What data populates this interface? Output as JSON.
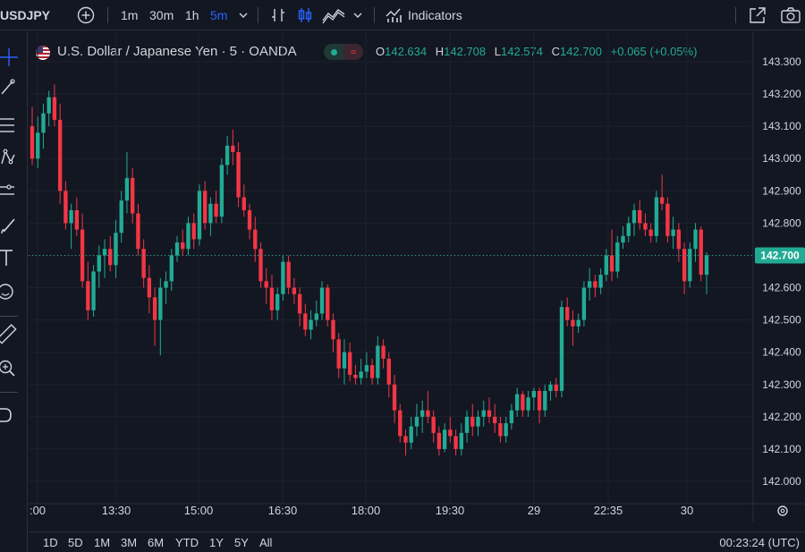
{
  "toolbar": {
    "symbol": "USDJPY",
    "intervals": [
      "1m",
      "30m",
      "1h",
      "5m"
    ],
    "active_interval": "5m",
    "indicators_label": "Indicators",
    "icons": [
      "add-symbol-icon",
      "chevron-down-icon",
      "bar-style-icon",
      "candle-style-icon",
      "area-style-icon",
      "indicators-icon",
      "fullscreen-icon",
      "camera-icon"
    ]
  },
  "legend": {
    "title": "U.S. Dollar / Japanese Yen · 5 · OANDA",
    "open_label": "O",
    "open": "142.634",
    "high_label": "H",
    "high": "142.708",
    "low_label": "L",
    "low": "142.574",
    "close_label": "C",
    "close": "142.700",
    "change": "+0.065 (+0.05%)",
    "wave_glyph": "≈"
  },
  "left_tools": [
    "crosshair-icon",
    "trendline-icon",
    "fib-icon",
    "pattern-icon",
    "projection-icon",
    "brush-icon",
    "text-icon",
    "emoji-icon",
    "ruler-icon",
    "zoom-icon",
    "magnet-icon"
  ],
  "bottom": {
    "ranges": [
      "1D",
      "5D",
      "1M",
      "3M",
      "6M",
      "YTD",
      "1Y",
      "5Y",
      "All"
    ],
    "clock": "00:23:24 (UTC)"
  },
  "colors": {
    "up": "#22ab94",
    "down": "#f23645",
    "background": "#131722",
    "grid": "#1e222d",
    "accent": "#2962ff"
  },
  "chart_data": {
    "type": "candlestick",
    "ylim": [
      141.95,
      143.35
    ],
    "y_ticks": [
      "143.300",
      "143.200",
      "143.100",
      "143.000",
      "142.900",
      "142.800",
      "142.700",
      "142.600",
      "142.500",
      "142.400",
      "142.300",
      "142.200",
      "142.100",
      "142.000"
    ],
    "x_ticks": [
      ":00",
      "13:30",
      "15:00",
      "16:30",
      "18:00",
      "19:30",
      "29",
      "22:35",
      "30"
    ],
    "last_price": "142.700",
    "candles": [
      [
        143.1,
        143.16,
        142.98,
        143.0
      ],
      [
        143.0,
        143.13,
        142.97,
        143.08
      ],
      [
        143.08,
        143.17,
        143.03,
        143.14
      ],
      [
        143.14,
        143.21,
        143.1,
        143.19
      ],
      [
        143.19,
        143.23,
        143.1,
        143.12
      ],
      [
        143.12,
        143.17,
        142.86,
        142.9
      ],
      [
        142.9,
        142.93,
        142.78,
        142.8
      ],
      [
        142.8,
        142.86,
        142.72,
        142.84
      ],
      [
        142.84,
        142.88,
        142.76,
        142.78
      ],
      [
        142.78,
        142.83,
        142.6,
        142.62
      ],
      [
        142.62,
        142.68,
        142.5,
        142.53
      ],
      [
        142.53,
        142.67,
        142.51,
        142.65
      ],
      [
        142.65,
        142.73,
        142.6,
        142.7
      ],
      [
        142.7,
        142.75,
        142.63,
        142.72
      ],
      [
        142.72,
        142.76,
        142.65,
        142.67
      ],
      [
        142.67,
        142.81,
        142.63,
        142.77
      ],
      [
        142.77,
        142.9,
        142.74,
        142.87
      ],
      [
        142.87,
        143.02,
        142.83,
        142.94
      ],
      [
        142.94,
        142.97,
        142.8,
        142.83
      ],
      [
        142.83,
        142.86,
        142.7,
        142.72
      ],
      [
        142.72,
        142.75,
        142.6,
        142.63
      ],
      [
        142.63,
        142.67,
        142.52,
        142.57
      ],
      [
        142.57,
        142.6,
        142.42,
        142.5
      ],
      [
        142.5,
        142.63,
        142.39,
        142.6
      ],
      [
        142.6,
        142.65,
        142.55,
        142.62
      ],
      [
        142.62,
        142.72,
        142.59,
        142.7
      ],
      [
        142.7,
        142.76,
        142.68,
        142.74
      ],
      [
        142.74,
        142.78,
        142.7,
        142.72
      ],
      [
        142.72,
        142.82,
        142.7,
        142.8
      ],
      [
        142.8,
        142.83,
        142.72,
        142.75
      ],
      [
        142.75,
        142.92,
        142.73,
        142.9
      ],
      [
        142.9,
        142.93,
        142.78,
        142.8
      ],
      [
        142.8,
        142.88,
        142.76,
        142.86
      ],
      [
        142.86,
        142.9,
        142.8,
        142.82
      ],
      [
        142.82,
        143.0,
        142.8,
        142.98
      ],
      [
        142.98,
        143.07,
        142.95,
        143.04
      ],
      [
        143.04,
        143.09,
        142.98,
        143.02
      ],
      [
        143.02,
        143.05,
        142.85,
        142.88
      ],
      [
        142.88,
        142.92,
        142.82,
        142.84
      ],
      [
        142.84,
        142.86,
        142.75,
        142.78
      ],
      [
        142.78,
        142.82,
        142.68,
        142.72
      ],
      [
        142.72,
        142.74,
        142.6,
        142.62
      ],
      [
        142.62,
        142.66,
        142.55,
        142.6
      ],
      [
        142.6,
        142.64,
        142.5,
        142.53
      ],
      [
        142.53,
        142.6,
        142.5,
        142.58
      ],
      [
        142.58,
        142.7,
        142.56,
        142.68
      ],
      [
        142.68,
        142.7,
        142.58,
        142.6
      ],
      [
        142.6,
        142.63,
        142.55,
        142.58
      ],
      [
        142.58,
        142.6,
        142.48,
        142.52
      ],
      [
        142.52,
        142.55,
        142.45,
        142.47
      ],
      [
        142.47,
        142.53,
        142.44,
        142.5
      ],
      [
        142.5,
        142.56,
        142.48,
        142.52
      ],
      [
        142.52,
        142.62,
        142.5,
        142.6
      ],
      [
        142.6,
        142.61,
        142.48,
        142.5
      ],
      [
        142.5,
        142.52,
        142.4,
        142.44
      ],
      [
        142.44,
        142.46,
        142.32,
        142.35
      ],
      [
        142.35,
        142.44,
        142.3,
        142.4
      ],
      [
        142.4,
        142.43,
        142.31,
        142.33
      ],
      [
        142.33,
        142.36,
        142.3,
        142.32
      ],
      [
        142.32,
        142.38,
        142.3,
        142.34
      ],
      [
        142.34,
        142.4,
        142.32,
        142.36
      ],
      [
        142.36,
        142.38,
        142.3,
        142.32
      ],
      [
        142.32,
        142.45,
        142.3,
        142.42
      ],
      [
        142.42,
        142.44,
        142.35,
        142.38
      ],
      [
        142.38,
        142.4,
        142.26,
        142.3
      ],
      [
        142.3,
        142.33,
        142.18,
        142.22
      ],
      [
        142.22,
        142.24,
        142.12,
        142.14
      ],
      [
        142.14,
        142.16,
        142.08,
        142.12
      ],
      [
        142.12,
        142.2,
        142.1,
        142.17
      ],
      [
        142.17,
        142.24,
        142.14,
        142.2
      ],
      [
        142.2,
        142.25,
        142.15,
        142.22
      ],
      [
        142.22,
        142.28,
        142.18,
        142.2
      ],
      [
        142.2,
        142.22,
        142.12,
        142.15
      ],
      [
        142.15,
        142.17,
        142.08,
        142.1
      ],
      [
        142.1,
        142.18,
        142.09,
        142.16
      ],
      [
        142.16,
        142.2,
        142.12,
        142.14
      ],
      [
        142.14,
        142.16,
        142.08,
        142.1
      ],
      [
        142.1,
        142.18,
        142.08,
        142.15
      ],
      [
        142.15,
        142.22,
        142.12,
        142.2
      ],
      [
        142.2,
        142.24,
        142.14,
        142.17
      ],
      [
        142.17,
        142.22,
        142.14,
        142.2
      ],
      [
        142.2,
        142.25,
        142.17,
        142.22
      ],
      [
        142.22,
        142.26,
        142.18,
        142.2
      ],
      [
        142.2,
        142.24,
        142.15,
        142.18
      ],
      [
        142.18,
        142.2,
        142.12,
        142.14
      ],
      [
        142.14,
        142.2,
        142.12,
        142.18
      ],
      [
        142.18,
        142.24,
        142.16,
        142.22
      ],
      [
        142.22,
        142.29,
        142.2,
        142.27
      ],
      [
        142.27,
        142.28,
        142.2,
        142.22
      ],
      [
        142.22,
        142.28,
        142.2,
        142.26
      ],
      [
        142.26,
        142.29,
        142.22,
        142.28
      ],
      [
        142.28,
        142.29,
        142.18,
        142.22
      ],
      [
        142.22,
        142.3,
        142.2,
        142.28
      ],
      [
        142.28,
        142.31,
        142.25,
        142.3
      ],
      [
        142.3,
        142.32,
        142.26,
        142.28
      ],
      [
        142.28,
        142.56,
        142.26,
        142.54
      ],
      [
        142.54,
        142.57,
        142.48,
        142.5
      ],
      [
        142.5,
        142.53,
        142.42,
        142.48
      ],
      [
        142.48,
        142.52,
        142.46,
        142.5
      ],
      [
        142.5,
        142.62,
        142.48,
        142.6
      ],
      [
        142.6,
        142.66,
        142.56,
        142.62
      ],
      [
        142.62,
        142.64,
        142.57,
        142.6
      ],
      [
        142.6,
        142.66,
        142.58,
        142.64
      ],
      [
        142.64,
        142.72,
        142.62,
        142.7
      ],
      [
        142.7,
        142.78,
        142.62,
        142.65
      ],
      [
        142.65,
        142.76,
        142.63,
        142.74
      ],
      [
        142.74,
        142.79,
        142.72,
        142.76
      ],
      [
        142.76,
        142.82,
        142.74,
        142.8
      ],
      [
        142.8,
        142.86,
        142.76,
        142.84
      ],
      [
        142.84,
        142.87,
        142.78,
        142.8
      ],
      [
        142.8,
        142.83,
        142.76,
        142.78
      ],
      [
        142.78,
        142.8,
        142.74,
        142.76
      ],
      [
        142.76,
        142.9,
        142.74,
        142.88
      ],
      [
        142.88,
        142.95,
        142.84,
        142.86
      ],
      [
        142.86,
        142.88,
        142.74,
        142.76
      ],
      [
        142.76,
        142.82,
        142.72,
        142.78
      ],
      [
        142.78,
        142.8,
        142.68,
        142.72
      ],
      [
        142.72,
        142.74,
        142.58,
        142.62
      ],
      [
        142.62,
        142.74,
        142.6,
        142.72
      ],
      [
        142.72,
        142.8,
        142.68,
        142.78
      ],
      [
        142.78,
        142.79,
        142.62,
        142.64
      ],
      [
        142.64,
        142.71,
        142.58,
        142.7
      ]
    ]
  }
}
